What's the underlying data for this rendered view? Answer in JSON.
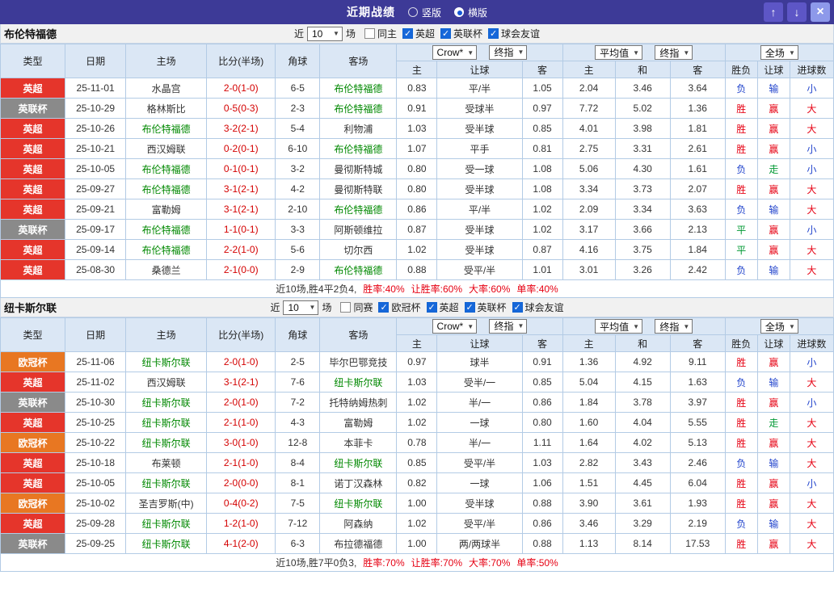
{
  "titlebar": {
    "title": "近期战绩",
    "radios": [
      {
        "label": "竖版",
        "checked": false
      },
      {
        "label": "横版",
        "checked": true
      }
    ],
    "buttons": {
      "up": "↑",
      "down": "↓",
      "close": "×"
    }
  },
  "labels": {
    "near": "近",
    "games": "场",
    "select_bookmaker": "Crow*",
    "select_final": "终指",
    "select_avg": "平均值",
    "select_full": "全场"
  },
  "table_header": {
    "type": "类型",
    "date": "日期",
    "home": "主场",
    "score": "比分(半场)",
    "corner": "角球",
    "away": "客场",
    "sub": [
      "主",
      "让球",
      "客",
      "主",
      "和",
      "客",
      "胜负",
      "让球",
      "进球数"
    ]
  },
  "league_colors": {
    "英超": "#e5352b",
    "英联杯": "#8a8a8a",
    "欧冠杯": "#e87722"
  },
  "result_colors": {
    "胜": "#e60012",
    "赢": "#e60012",
    "大": "#e60012",
    "负": "#2244cc",
    "输": "#2244cc",
    "小": "#2244cc",
    "平": "#009933",
    "走": "#009933"
  },
  "colors": {
    "titlebar": "#3d3a97",
    "focus_team": "#008800",
    "score": "#d40000",
    "header_bg": "#dbe7f5",
    "border": "#b3cbe5"
  },
  "sections": [
    {
      "team": "布伦特福德",
      "filter": {
        "count": "10",
        "checkboxes": [
          {
            "label": "同主",
            "checked": false
          },
          {
            "label": "英超",
            "checked": true
          },
          {
            "label": "英联杯",
            "checked": true
          },
          {
            "label": "球会友谊",
            "checked": true
          }
        ]
      },
      "rows": [
        [
          "英超",
          "25-11-01",
          "水晶宫",
          "2-0(1-0)",
          "6-5",
          "布伦特福德",
          "0.83",
          "平/半",
          "1.05",
          "2.04",
          "3.46",
          "3.64",
          "负",
          "输",
          "小"
        ],
        [
          "英联杯",
          "25-10-29",
          "格林斯比",
          "0-5(0-3)",
          "2-3",
          "布伦特福德",
          "0.91",
          "受球半",
          "0.97",
          "7.72",
          "5.02",
          "1.36",
          "胜",
          "赢",
          "大"
        ],
        [
          "英超",
          "25-10-26",
          "布伦特福德",
          "3-2(2-1)",
          "5-4",
          "利物浦",
          "1.03",
          "受半球",
          "0.85",
          "4.01",
          "3.98",
          "1.81",
          "胜",
          "赢",
          "大"
        ],
        [
          "英超",
          "25-10-21",
          "西汉姆联",
          "0-2(0-1)",
          "6-10",
          "布伦特福德",
          "1.07",
          "平手",
          "0.81",
          "2.75",
          "3.31",
          "2.61",
          "胜",
          "赢",
          "小"
        ],
        [
          "英超",
          "25-10-05",
          "布伦特福德",
          "0-1(0-1)",
          "3-2",
          "曼彻斯特城",
          "0.80",
          "受一球",
          "1.08",
          "5.06",
          "4.30",
          "1.61",
          "负",
          "走",
          "小"
        ],
        [
          "英超",
          "25-09-27",
          "布伦特福德",
          "3-1(2-1)",
          "4-2",
          "曼彻斯特联",
          "0.80",
          "受半球",
          "1.08",
          "3.34",
          "3.73",
          "2.07",
          "胜",
          "赢",
          "大"
        ],
        [
          "英超",
          "25-09-21",
          "富勒姆",
          "3-1(2-1)",
          "2-10",
          "布伦特福德",
          "0.86",
          "平/半",
          "1.02",
          "2.09",
          "3.34",
          "3.63",
          "负",
          "输",
          "大"
        ],
        [
          "英联杯",
          "25-09-17",
          "布伦特福德",
          "1-1(0-1)",
          "3-3",
          "阿斯顿维拉",
          "0.87",
          "受半球",
          "1.02",
          "3.17",
          "3.66",
          "2.13",
          "平",
          "赢",
          "小"
        ],
        [
          "英超",
          "25-09-14",
          "布伦特福德",
          "2-2(1-0)",
          "5-6",
          "切尔西",
          "1.02",
          "受半球",
          "0.87",
          "4.16",
          "3.75",
          "1.84",
          "平",
          "赢",
          "大"
        ],
        [
          "英超",
          "25-08-30",
          "桑德兰",
          "2-1(0-0)",
          "2-9",
          "布伦特福德",
          "0.88",
          "受平/半",
          "1.01",
          "3.01",
          "3.26",
          "2.42",
          "负",
          "输",
          "大"
        ]
      ],
      "footer": {
        "prefix": "近10场,胜4平2负4,",
        "stats": [
          "胜率:40%",
          "让胜率:60%",
          "大率:60%",
          "单率:40%"
        ]
      }
    },
    {
      "team": "纽卡斯尔联",
      "filter": {
        "count": "10",
        "checkboxes": [
          {
            "label": "同赛",
            "checked": false
          },
          {
            "label": "欧冠杯",
            "checked": true
          },
          {
            "label": "英超",
            "checked": true
          },
          {
            "label": "英联杯",
            "checked": true
          },
          {
            "label": "球会友谊",
            "checked": true
          }
        ]
      },
      "rows": [
        [
          "欧冠杯",
          "25-11-06",
          "纽卡斯尔联",
          "2-0(1-0)",
          "2-5",
          "毕尔巴鄂竞技",
          "0.97",
          "球半",
          "0.91",
          "1.36",
          "4.92",
          "9.11",
          "胜",
          "赢",
          "小"
        ],
        [
          "英超",
          "25-11-02",
          "西汉姆联",
          "3-1(2-1)",
          "7-6",
          "纽卡斯尔联",
          "1.03",
          "受半/一",
          "0.85",
          "5.04",
          "4.15",
          "1.63",
          "负",
          "输",
          "大"
        ],
        [
          "英联杯",
          "25-10-30",
          "纽卡斯尔联",
          "2-0(1-0)",
          "7-2",
          "托特纳姆热刺",
          "1.02",
          "半/一",
          "0.86",
          "1.84",
          "3.78",
          "3.97",
          "胜",
          "赢",
          "小"
        ],
        [
          "英超",
          "25-10-25",
          "纽卡斯尔联",
          "2-1(1-0)",
          "4-3",
          "富勒姆",
          "1.02",
          "一球",
          "0.80",
          "1.60",
          "4.04",
          "5.55",
          "胜",
          "走",
          "大"
        ],
        [
          "欧冠杯",
          "25-10-22",
          "纽卡斯尔联",
          "3-0(1-0)",
          "12-8",
          "本菲卡",
          "0.78",
          "半/一",
          "1.11",
          "1.64",
          "4.02",
          "5.13",
          "胜",
          "赢",
          "大"
        ],
        [
          "英超",
          "25-10-18",
          "布莱顿",
          "2-1(1-0)",
          "8-4",
          "纽卡斯尔联",
          "0.85",
          "受平/半",
          "1.03",
          "2.82",
          "3.43",
          "2.46",
          "负",
          "输",
          "大"
        ],
        [
          "英超",
          "25-10-05",
          "纽卡斯尔联",
          "2-0(0-0)",
          "8-1",
          "诺丁汉森林",
          "0.82",
          "一球",
          "1.06",
          "1.51",
          "4.45",
          "6.04",
          "胜",
          "赢",
          "小"
        ],
        [
          "欧冠杯",
          "25-10-02",
          "圣吉罗斯(中)",
          "0-4(0-2)",
          "7-5",
          "纽卡斯尔联",
          "1.00",
          "受半球",
          "0.88",
          "3.90",
          "3.61",
          "1.93",
          "胜",
          "赢",
          "大"
        ],
        [
          "英超",
          "25-09-28",
          "纽卡斯尔联",
          "1-2(1-0)",
          "7-12",
          "阿森纳",
          "1.02",
          "受平/半",
          "0.86",
          "3.46",
          "3.29",
          "2.19",
          "负",
          "输",
          "大"
        ],
        [
          "英联杯",
          "25-09-25",
          "纽卡斯尔联",
          "4-1(2-0)",
          "6-3",
          "布拉德福德",
          "1.00",
          "两/两球半",
          "0.88",
          "1.13",
          "8.14",
          "17.53",
          "胜",
          "赢",
          "大"
        ]
      ],
      "footer": {
        "prefix": "近10场,胜7平0负3,",
        "stats": [
          "胜率:70%",
          "让胜率:70%",
          "大率:70%",
          "单率:50%"
        ]
      }
    }
  ]
}
